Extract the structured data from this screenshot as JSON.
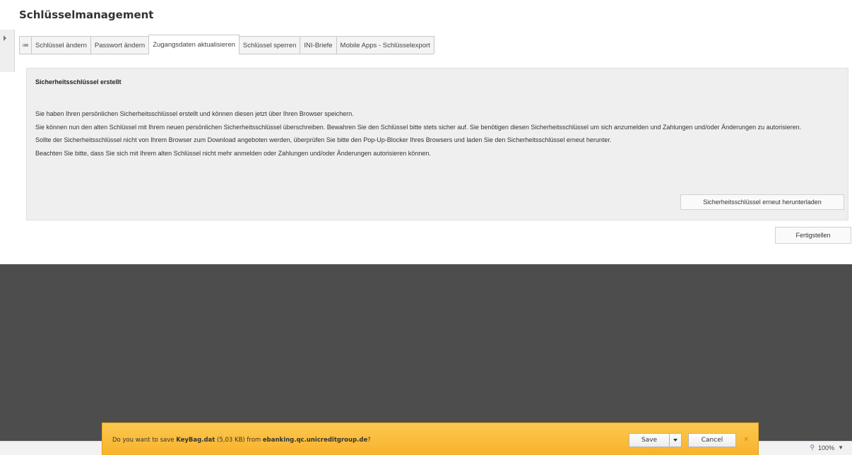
{
  "page": {
    "title": "Schlüsselmanagement"
  },
  "tabs": {
    "menu_icon": "≔",
    "items": [
      {
        "label": "Schlüssel ändern"
      },
      {
        "label": "Passwort ändern"
      },
      {
        "label": "Zugangsdaten aktualisieren",
        "active": true
      },
      {
        "label": "Schlüssel sperren"
      },
      {
        "label": "INI-Briefe"
      },
      {
        "label": "Mobile Apps - Schlüsselexport"
      }
    ]
  },
  "panel": {
    "heading": "Sicherheitsschlüssel erstellt",
    "paragraphs": [
      "Sie haben Ihren persönlichen Sicherheitsschlüssel erstellt und können diesen jetzt über Ihren Browser speichern.",
      "Sie können nun den alten Schlüssel mit Ihrem neuen persönlichen Sicherheitsschlüssel überschreiben. Bewahren Sie den Schlüssel bitte stets sicher auf. Sie benötigen diesen Sicherheitsschlüssel um sich anzumelden und Zahlungen und/oder Änderungen zu autorisieren.",
      "Sollte der Sicherheitsschlüssel nicht von Ihrem Browser zum Download angeboten werden, überprüfen Sie bitte den Pop-Up-Blocker Ihres Browsers und laden Sie den Sicherheitsschlüssel erneut herunter.",
      "Beachten Sie bitte, dass Sie sich mit Ihrem alten Schlüssel nicht mehr anmelden oder Zahlungen und/oder Änderungen autorisieren können."
    ],
    "redownload_label": "Sicherheitsschlüssel erneut herunterladen"
  },
  "finish_label": "Fertigstellen",
  "download_bar": {
    "prefix": "Do you want to save ",
    "filename": "KeyBag.dat",
    "size": " (5,03 KB) from ",
    "host": "ebanking.qc.unicreditgroup.de",
    "suffix": "?",
    "save_label": "Save",
    "cancel_label": "Cancel",
    "close_glyph": "×"
  },
  "status": {
    "zoom": "100%",
    "zoom_icon": "magnifier-icon"
  }
}
